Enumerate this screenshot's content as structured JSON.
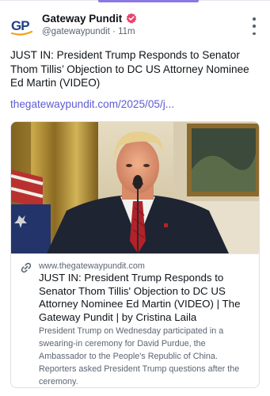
{
  "author": {
    "display_name": "Gateway Pundit",
    "handle": "@gatewaypundit",
    "separator": "·",
    "timestamp": "11m",
    "avatar_text": "GP",
    "verified": true
  },
  "post": {
    "text": "JUST IN: President Trump Responds to Senator Thom Tillis’ Objection to DC US Attorney Nominee Ed Martin (VIDEO)",
    "link_text": "thegatewaypundit.com/2025/05/j..."
  },
  "link_card": {
    "domain": "www.thegatewaypundit.com",
    "title": "JUST IN: President Trump Responds to Senator Thom Tillis' Objection to DC US Attorney Nominee Ed Martin (VIDEO) | The Gateway Pundit | by Cristina Laila",
    "description": "President Trump on Wednesday participated in a swearing-in ceremony for David Purdue, the Ambassador to the People's Republic of China. Reporters asked President Trump questions after the ceremony."
  },
  "colors": {
    "accent": "#8b78e6",
    "link": "#5c5bd6",
    "verified_badge": "#e8456b",
    "avatar_blue": "#1f3e8a",
    "avatar_orange": "#f4a11a",
    "muted_text": "#5b6573"
  },
  "icons": {
    "more": "more-vertical-icon",
    "link": "link-icon",
    "verified": "verified-badge-icon"
  }
}
